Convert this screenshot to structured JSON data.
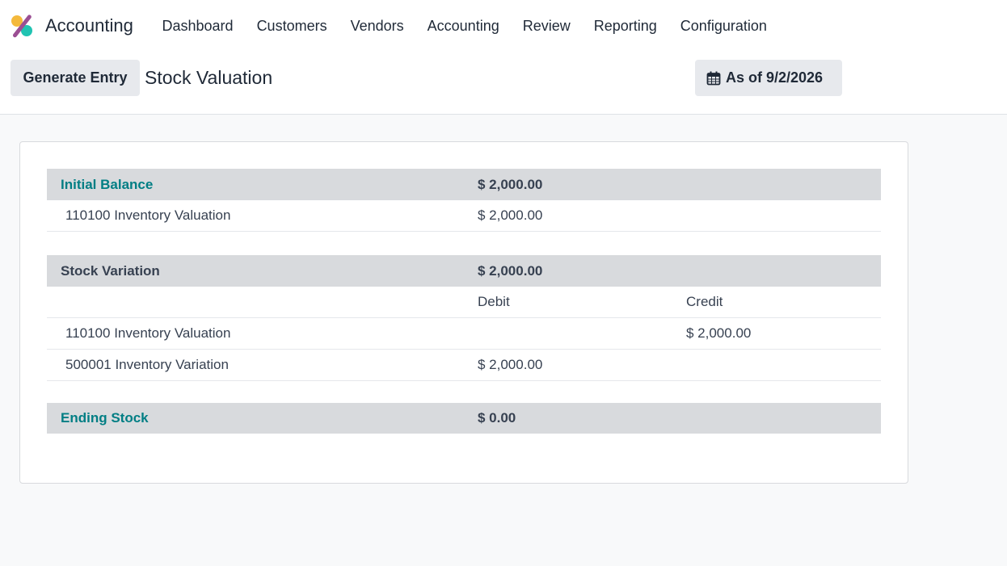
{
  "navbar": {
    "app_name": "Accounting",
    "menu": [
      "Dashboard",
      "Customers",
      "Vendors",
      "Accounting",
      "Review",
      "Reporting",
      "Configuration"
    ]
  },
  "control_panel": {
    "generate_label": "Generate Entry",
    "title": "Stock Valuation",
    "date_label": "As of 9/2/2026",
    "date_icon": "calendar-icon"
  },
  "report": {
    "initial_balance": {
      "label": "Initial Balance",
      "amount": "$ 2,000.00",
      "lines": [
        {
          "account": "110100 Inventory Valuation",
          "amount": "$ 2,000.00"
        }
      ]
    },
    "stock_variation": {
      "label": "Stock Variation",
      "amount": "$ 2,000.00",
      "debit_header": "Debit",
      "credit_header": "Credit",
      "lines": [
        {
          "account": "110100 Inventory Valuation",
          "debit": "",
          "credit": "$ 2,000.00"
        },
        {
          "account": "500001 Inventory Variation",
          "debit": "$ 2,000.00",
          "credit": ""
        }
      ]
    },
    "ending_stock": {
      "label": "Ending Stock",
      "amount": "$ 0.00"
    }
  },
  "colors": {
    "accent_teal": "#017e84",
    "header_gray": "#d8dadd"
  }
}
